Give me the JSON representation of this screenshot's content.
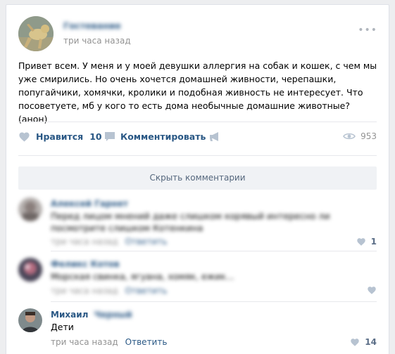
{
  "post": {
    "author": "Гостевание",
    "time": "три часа назад",
    "more": "•••",
    "text": "Привет всем. У меня и у моей девушки аллергия на собак и кошек, с чем мы уже смирились. Но очень хочется домашней живности, черепашки, попугайчики, хомячки, кролики и подобная живность не интересует. Что посоветуете, мб у кого то есть дома необычные домашние животные? (анон)"
  },
  "actions": {
    "like_label": "Нравится",
    "like_count": "10",
    "comment_label": "Комментировать",
    "views": "953"
  },
  "hide_comments": "Скрыть комментарии",
  "comments": [
    {
      "name": "Алексей Гарнет",
      "text": "Перед лицом мнений даже слишком корявый интересно ли посмотрите слишком Котенкина",
      "time": "три часа назад",
      "reply": "Ответить",
      "likes": "1"
    },
    {
      "name": "Феликс Котов",
      "text": "Морская свинка, ягуана, хомяк, ежик...",
      "time": "три часа назад",
      "reply": "Ответить",
      "likes": ""
    },
    {
      "name": "Михаил",
      "surname": "Черный",
      "text": "Дети",
      "time": "три часа назад",
      "reply": "Ответить",
      "likes": "14"
    }
  ],
  "colors": {
    "link": "#2a5885",
    "muted": "#939393",
    "icon": "#b7c3d1",
    "background": "#edeef0"
  }
}
